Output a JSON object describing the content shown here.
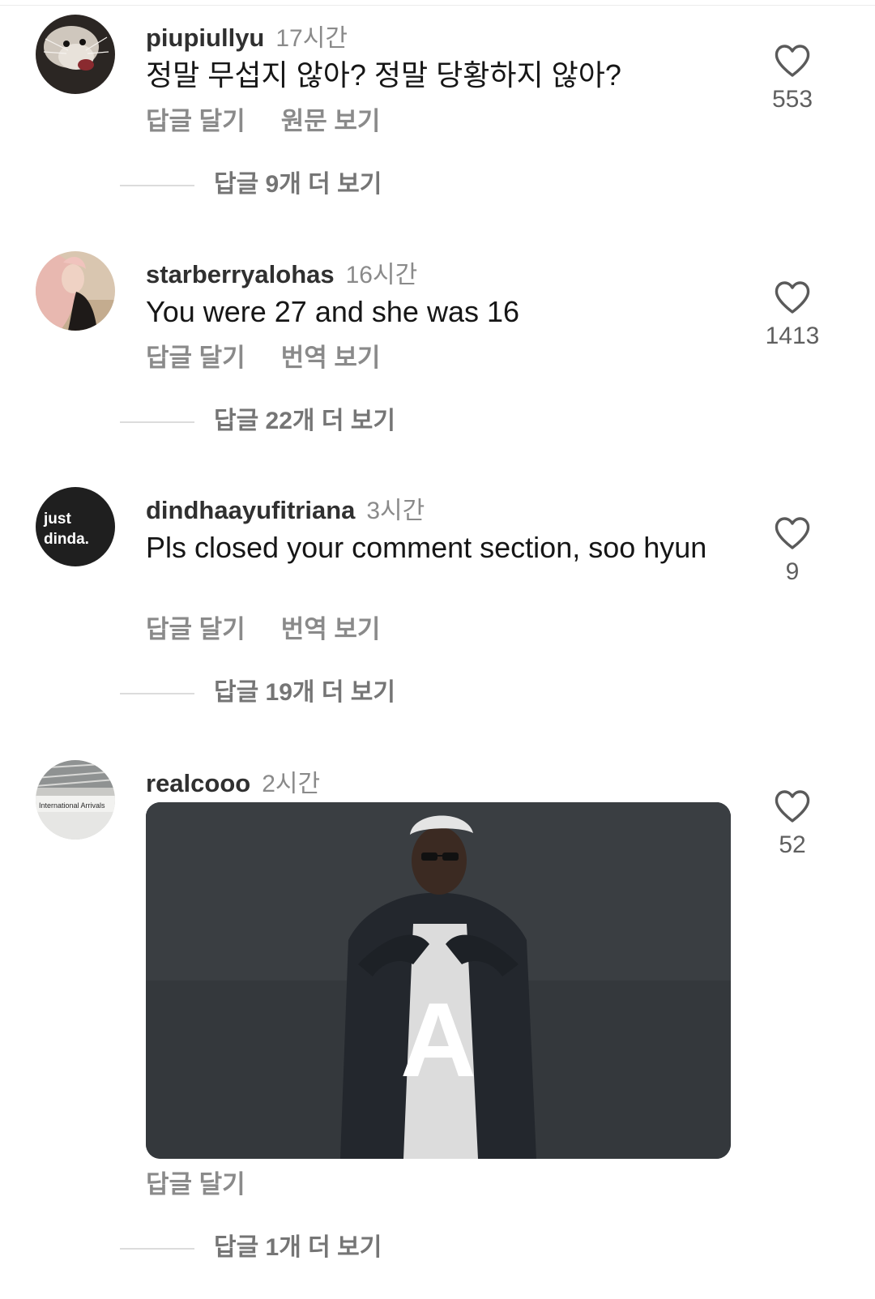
{
  "comments": [
    {
      "username": "piupiullyu",
      "time": "17시간",
      "text": "정말 무섭지 않아? 정말 당황하지 않아?",
      "reply_label": "답글 달기",
      "secondary_label": "원문 보기",
      "like_count": "553",
      "view_replies": "답글 9개 더 보기"
    },
    {
      "username": "starberryalohas",
      "time": "16시간",
      "text": "You were 27 and she was 16",
      "reply_label": "답글 달기",
      "secondary_label": "번역 보기",
      "like_count": "1413",
      "view_replies": "답글 22개 더 보기"
    },
    {
      "username": "dindhaayufitriana",
      "time": "3시간",
      "text": "Pls closed your comment section, soo hyun",
      "reply_label": "답글 달기",
      "secondary_label": "번역 보기",
      "like_count": "9",
      "view_replies": "답글 19개 더 보기",
      "avatar_text_1": "just",
      "avatar_text_2": "dinda."
    },
    {
      "username": "realcooo",
      "time": "2시간",
      "reply_label": "답글 달기",
      "like_count": "52",
      "view_replies": "답글 1개 더 보기",
      "gif_letter": "A",
      "avatar_sign": "International Arrivals"
    }
  ],
  "icons": {
    "like": "heart-outline-icon"
  },
  "colors": {
    "username": "#303030",
    "muted": "#8a8a8a",
    "text": "#161616"
  }
}
